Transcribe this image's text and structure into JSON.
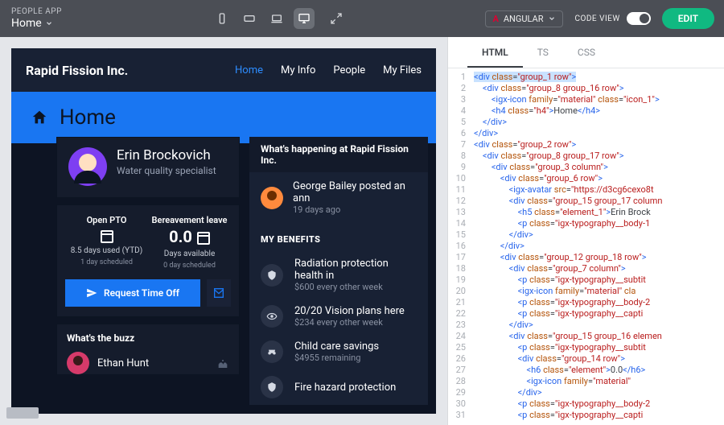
{
  "topbar": {
    "breadcrumb": "PEOPLE APP",
    "page": "Home",
    "framework": "ANGULAR",
    "code_view_label": "CODE VIEW",
    "edit_label": "EDIT"
  },
  "app": {
    "brand": "Rapid Fission Inc.",
    "nav": [
      "Home",
      "My Info",
      "People",
      "My Files"
    ],
    "nav_active": 0,
    "banner_title": "Home",
    "profile": {
      "name": "Erin Brockovich",
      "role": "Water quality specialist"
    },
    "pto": {
      "left": {
        "label": "Open PTO",
        "big": "",
        "sub": "8.5 days used (YTD)",
        "note": "1 day scheduled"
      },
      "right": {
        "label": "Bereavement leave",
        "big": "0.0",
        "sub": "Days available",
        "note": "0 day scheduled"
      },
      "request_label": "Request Time Off"
    },
    "buzz": {
      "header": "What's the buzz",
      "person": "Ethan Hunt"
    },
    "happening": {
      "header": "What's happening at Rapid Fission Inc.",
      "title": "George Bailey posted an ann",
      "age": "19 days ago"
    },
    "benefits": {
      "header": "MY BENEFITS",
      "items": [
        {
          "t": "Radiation protection health in",
          "s": "$600 every other week"
        },
        {
          "t": "20/20 Vision plans here",
          "s": "$234 every other week"
        },
        {
          "t": "Child care savings",
          "s": "$4955 remaining"
        },
        {
          "t": "Fire hazard protection",
          "s": ""
        }
      ]
    }
  },
  "code_tabs": [
    "HTML",
    "TS",
    "CSS"
  ],
  "code_active": 0
}
